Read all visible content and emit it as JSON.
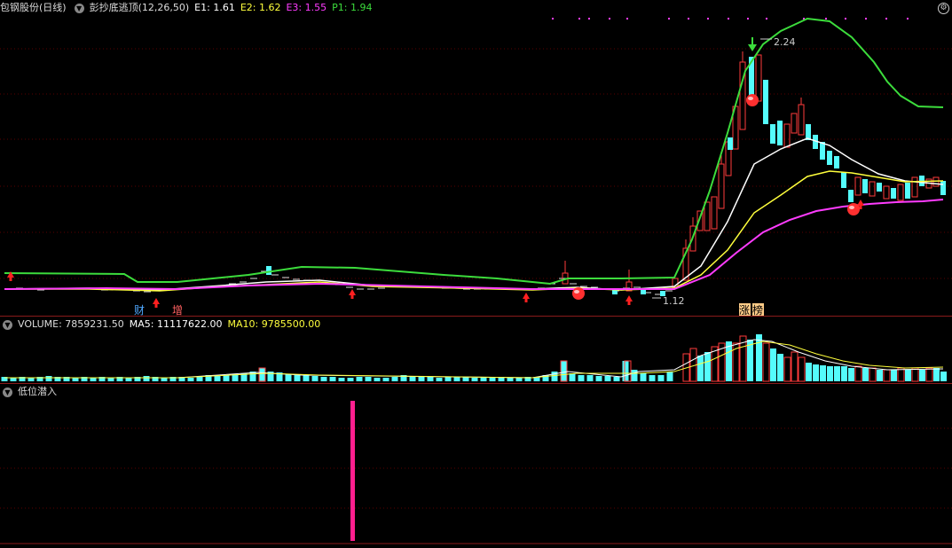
{
  "main_pane": {
    "stock_name": "包钢股份(日线)",
    "indicator": {
      "name": "彭抄底逃顶(12,26,50)",
      "e1_label": "E1:",
      "e1_value": "1.61",
      "e2_label": "E2:",
      "e2_value": "1.62",
      "e3_label": "E3:",
      "e3_value": "1.55",
      "p1_label": "P1:",
      "p1_value": "1.94"
    },
    "high_price_label": "2.24",
    "low_price_label": "1.12",
    "event_markers": [
      "财",
      "增",
      "涨",
      "榜"
    ],
    "colors": {
      "up": "#ff3b3b",
      "down": "#54fcfc",
      "e1": "#ffffff",
      "e2": "#ffff3c",
      "e3": "#ff3cff",
      "p1": "#3cdc3c"
    }
  },
  "volume_pane": {
    "volume_label": "VOLUME:",
    "volume_value": "7859231.50",
    "ma5_label": "MA5:",
    "ma5_value": "11117622.00",
    "ma10_label": "MA10:",
    "ma10_value": "9785500.00"
  },
  "signal_pane": {
    "title": "低位潜入"
  }
}
